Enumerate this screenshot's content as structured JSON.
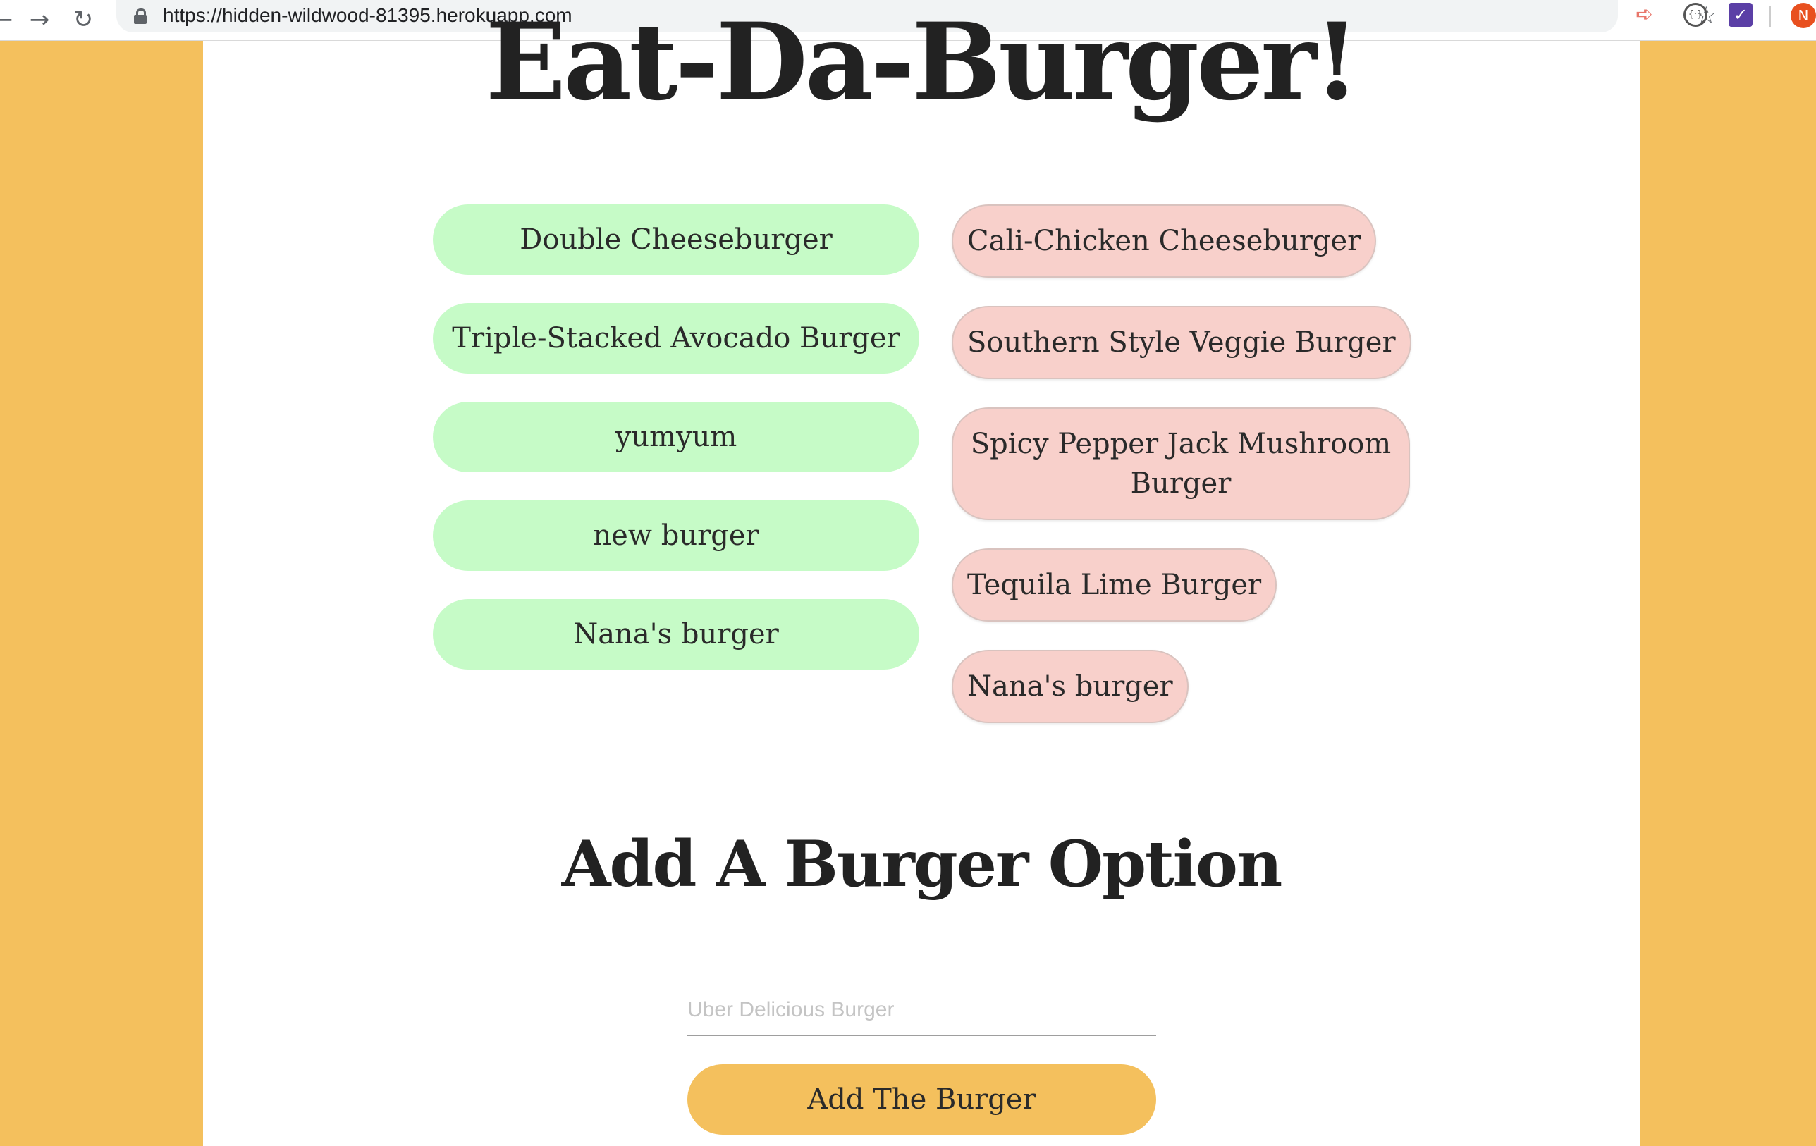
{
  "browser": {
    "url": "https://hidden-wildwood-81395.herokuapp.com",
    "avatar_initial": "N"
  },
  "page": {
    "title": "Eat-Da-Burger!",
    "colors": {
      "background": "#f4c05d",
      "panel": "#ffffff",
      "uneaten_pill": "#c6fbc7",
      "devoured_pill": "#f8d0cb",
      "button": "#f4c05d"
    },
    "uneaten_burgers": [
      "Double Cheeseburger",
      "Triple-Stacked Avocado Burger",
      "yumyum",
      "new burger",
      "Nana's burger"
    ],
    "devoured_burgers": [
      "Cali-Chicken Cheeseburger",
      "Southern Style Veggie Burger",
      "Spicy Pepper Jack Mushroom Burger",
      "Tequila Lime Burger",
      "Nana's burger"
    ],
    "add_form": {
      "heading": "Add A Burger Option",
      "placeholder": "Uber Delicious Burger",
      "button_label": "Add The Burger"
    }
  }
}
